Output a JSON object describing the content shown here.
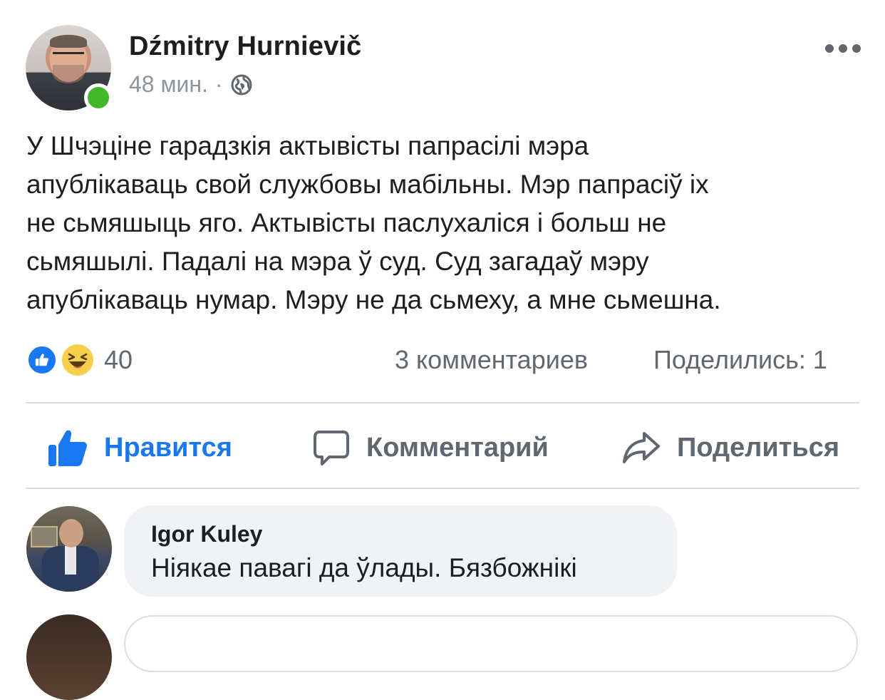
{
  "post": {
    "author": "Dźmitry Hurnievič",
    "time": "48 мин.",
    "separator": "·",
    "privacy_icon": "globe-icon",
    "text_lines": [
      "У Шчэціне гарадзкія актывісты папрасілі мэра",
      "апублікаваць свой службовы мабільны. Мэр папрасіў іх",
      "не сьмяшыць яго. Актывісты паслухаліся і больш не",
      "сьмяшылі. Падалі на мэра ў суд. Суд загадаў мэру",
      "апублікаваць нумар. Мэру не да сьмеху, а мне сьмешна."
    ]
  },
  "summary": {
    "reactions": [
      "like-icon",
      "haha-icon"
    ],
    "reaction_count": "40",
    "comments": "3 комментариев",
    "shares": "Поделились: 1"
  },
  "actions": {
    "like": "Нравится",
    "comment": "Комментарий",
    "share": "Поделиться"
  },
  "comments": [
    {
      "author": "Igor Kuley",
      "text": "Ніякае павагі да ўлады. Бязбожнікі"
    }
  ],
  "colors": {
    "accent": "#1877f2",
    "muted": "#606770",
    "online": "#42b72a",
    "bubble": "#f0f2f5"
  }
}
